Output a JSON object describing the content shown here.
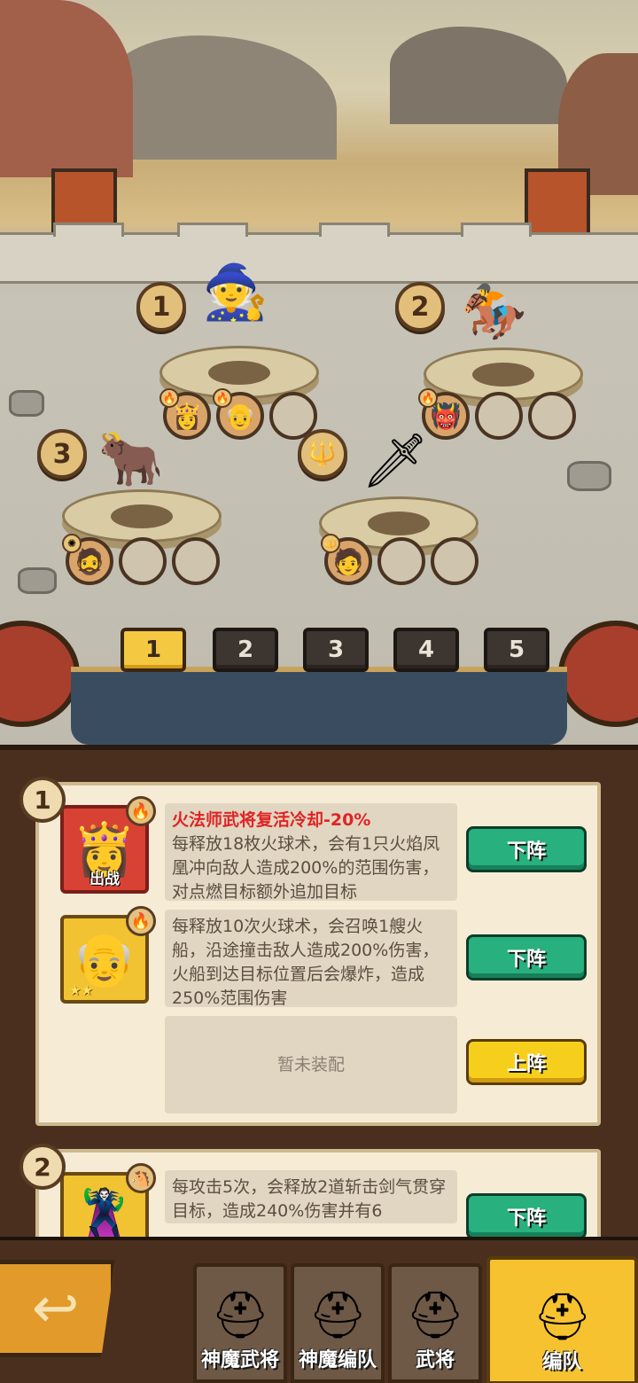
{
  "battlefield": {
    "slots": [
      {
        "number": "1",
        "hero_icon": "sage-hero",
        "equipped": [
          "fire-mage-portrait",
          "flame-elder-portrait",
          ""
        ]
      },
      {
        "number": "2",
        "hero_icon": "red-general-on-horse",
        "equipped": [
          "red-warlord-portrait",
          "",
          ""
        ]
      },
      {
        "number": "3",
        "hero_icon": "horned-warrior",
        "equipped": [
          "dark-warlord-portrait",
          "",
          ""
        ]
      },
      {
        "number": "trident-icon",
        "hero_icon": "green-swordsman",
        "equipped": [
          "swordsman-portrait",
          "",
          ""
        ]
      }
    ],
    "team_tabs": [
      "1",
      "2",
      "3",
      "4",
      "5"
    ],
    "active_team": "1"
  },
  "cards": [
    {
      "number": "1",
      "heroes": [
        {
          "portrait_color": "red",
          "element": "fire",
          "tag": "出战",
          "effect": "火法师武将复活冷却-20%",
          "description": "每释放18枚火球术，会有1只火焰凤凰冲向敌人造成200%的范围伤害，对点燃目标额外追加目标",
          "button": "下阵",
          "button_style": "green"
        },
        {
          "portrait_color": "gold",
          "element": "fire",
          "stars": "★★",
          "effect": "",
          "description": "每释放10次火球术，会召唤1艘火船，沿途撞击敌人造成200%伤害，火船到达目标位置后会爆炸，造成250%范围伤害",
          "button": "下阵",
          "button_style": "green"
        },
        {
          "empty_text": "暂未装配",
          "button": "上阵",
          "button_style": "yellow"
        }
      ]
    },
    {
      "number": "2",
      "heroes": [
        {
          "portrait_color": "gold",
          "element": "horse",
          "description": "每攻击5次，会释放2道斩击剑气贯穿目标，造成240%伤害并有6",
          "button": "下阵",
          "button_style": "green"
        }
      ]
    }
  ],
  "nav": {
    "back_icon": "back-arrow-icon",
    "items": [
      {
        "label": "神魔武将"
      },
      {
        "label": "神魔编队"
      },
      {
        "label": "武将"
      },
      {
        "label": "编队",
        "active": true
      }
    ]
  },
  "colors": {
    "accent_yellow": "#f6cf1d",
    "button_green": "#28b07e",
    "effect_red": "#e02424",
    "panel_brown": "#4a2f1f"
  }
}
